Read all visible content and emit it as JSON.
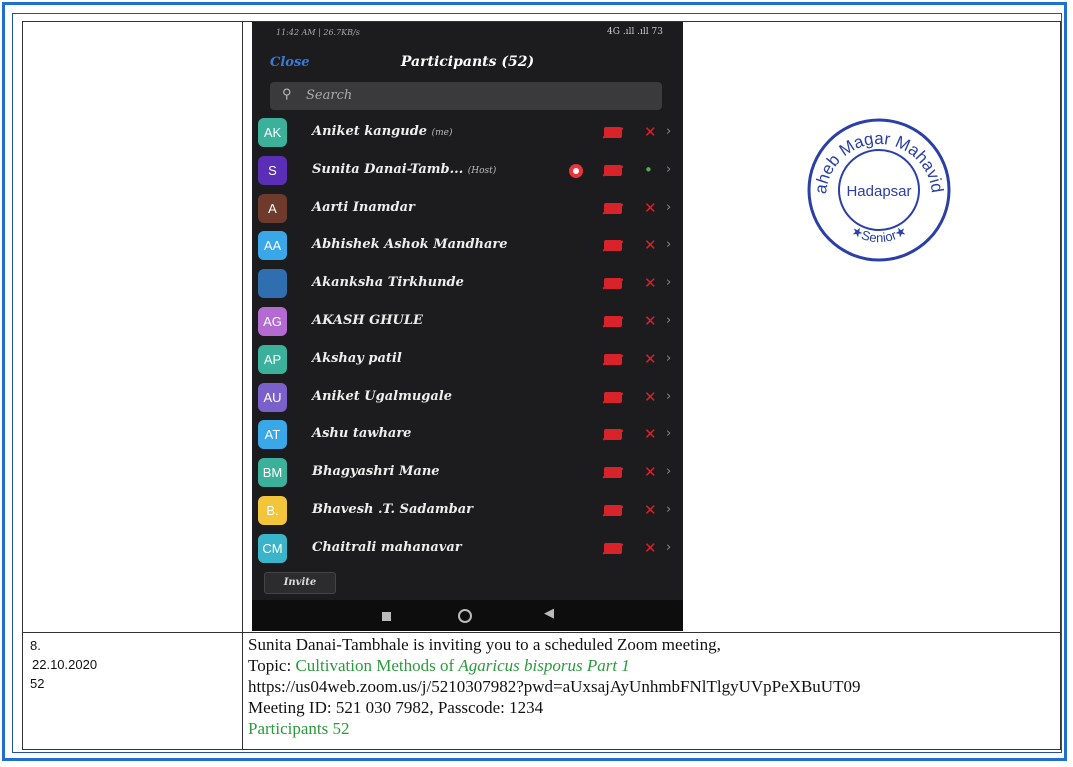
{
  "phone": {
    "status_left": "11:42 AM | 26.7KB/s",
    "status_right": "4G .ıll .ıll 73",
    "close_label": "Close",
    "title": "Participants (52)",
    "search_placeholder": "Search",
    "invite_label": "Invite",
    "participants": [
      {
        "initials": "AK",
        "color": "#3bb09a",
        "name": "Aniket kangude",
        "tag": "(me)",
        "mic": "muted"
      },
      {
        "initials": "S",
        "color": "#5b2fb5",
        "name": "Sunita Danai-Tamb...",
        "tag": "(Host)",
        "mic": "on",
        "recording": true
      },
      {
        "initials": "A",
        "color": "#6e3a2b",
        "name": "Aarti Inamdar",
        "tag": "",
        "mic": "muted"
      },
      {
        "initials": "AA",
        "color": "#3aa7e8",
        "name": "Abhishek Ashok Mandhare",
        "tag": "",
        "mic": "muted"
      },
      {
        "initials": "",
        "color": "#2f6fb0",
        "name": "Akanksha Tirkhunde",
        "tag": "",
        "mic": "muted",
        "photo": true
      },
      {
        "initials": "AG",
        "color": "#b36ad1",
        "name": "AKASH GHULE",
        "tag": "",
        "mic": "muted"
      },
      {
        "initials": "AP",
        "color": "#3bb09a",
        "name": "Akshay patil",
        "tag": "",
        "mic": "muted"
      },
      {
        "initials": "AU",
        "color": "#7a61c9",
        "name": "Aniket Ugalmugale",
        "tag": "",
        "mic": "muted"
      },
      {
        "initials": "AT",
        "color": "#3aa7e8",
        "name": "Ashu tawhare",
        "tag": "",
        "mic": "muted"
      },
      {
        "initials": "BM",
        "color": "#3bb09a",
        "name": "Bhagyashri Mane",
        "tag": "",
        "mic": "muted"
      },
      {
        "initials": "B.",
        "color": "#f2c53a",
        "name": "Bhavesh .T. Sadambar",
        "tag": "",
        "mic": "muted"
      },
      {
        "initials": "CM",
        "color": "#3ab4c9",
        "name": "Chaitrali mahanavar",
        "tag": "",
        "mic": "muted"
      }
    ]
  },
  "seal": {
    "top_text": "Annasaheb Magar Mahavidyalaya",
    "center_text": "Hadapsar",
    "bottom_text": "★Senior★",
    "color": "#2a3fa8"
  },
  "row": {
    "serial": "8.",
    "date": "22.10.2020",
    "count": "52",
    "line1": "Sunita Danai-Tambhale is inviting you to a scheduled Zoom meeting,",
    "topic_label": "Topic: ",
    "topic_prefix": "Cultivation Methods of ",
    "topic_italic": "Agaricus bisporus Part 1",
    "link": "https://us04web.zoom.us/j/5210307982?pwd=aUxsajAyUnhmbFNlTlgyUVpPeXBuUT09",
    "meeting": "Meeting ID: 521 030 7982, Passcode: 1234",
    "participants": "Participants 52"
  }
}
